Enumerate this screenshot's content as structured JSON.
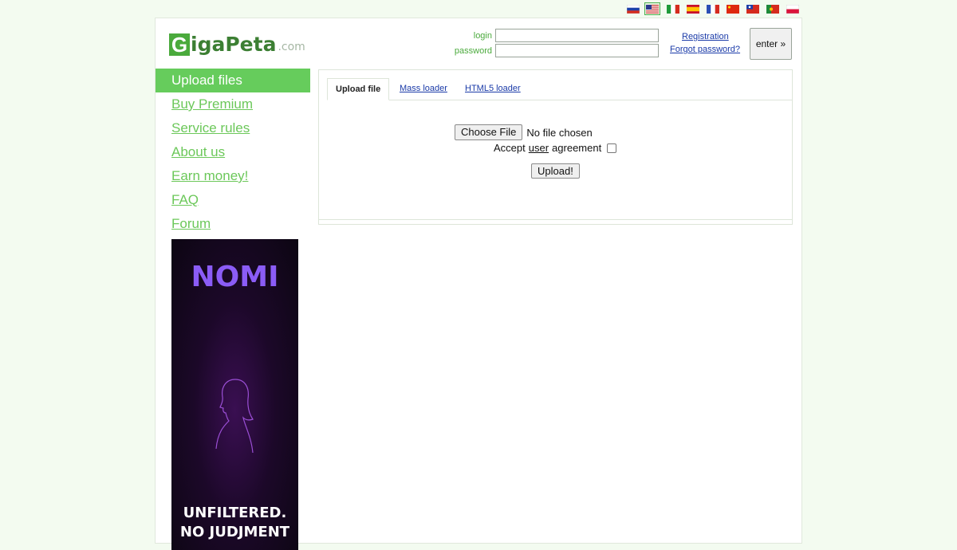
{
  "languages": [
    {
      "code": "ru",
      "selected": false
    },
    {
      "code": "en",
      "selected": true
    },
    {
      "code": "it",
      "selected": false
    },
    {
      "code": "es",
      "selected": false
    },
    {
      "code": "fr",
      "selected": false
    },
    {
      "code": "cn",
      "selected": false
    },
    {
      "code": "tw",
      "selected": false
    },
    {
      "code": "pt",
      "selected": false
    },
    {
      "code": "pl",
      "selected": false
    }
  ],
  "logo": {
    "initial": "G",
    "rest": "igaPeta",
    "suffix": ".com"
  },
  "login": {
    "login_label": "login",
    "password_label": "password",
    "login_value": "",
    "password_value": "",
    "registration": "Registration",
    "forgot": "Forgot password?",
    "enter": "enter »"
  },
  "nav": [
    {
      "label": "Upload files",
      "active": true
    },
    {
      "label": "Buy Premium",
      "active": false
    },
    {
      "label": "Service rules",
      "active": false
    },
    {
      "label": "About us",
      "active": false
    },
    {
      "label": "Earn money!",
      "active": false
    },
    {
      "label": "FAQ",
      "active": false
    },
    {
      "label": "Forum",
      "active": false
    }
  ],
  "ad": {
    "brand": "NOMI",
    "tagline1": "UNFILTERED.",
    "tagline2": "NO JUDJMENT"
  },
  "tabs": [
    {
      "label": "Upload file",
      "active": true
    },
    {
      "label": "Mass loader",
      "active": false
    },
    {
      "label": "HTML5 loader",
      "active": false
    }
  ],
  "upload": {
    "choose_file": "Choose File",
    "file_status": "No file chosen",
    "accept_before": "Accept",
    "accept_link": "user",
    "accept_after": "agreement",
    "accepted": false,
    "submit": "Upload!"
  },
  "colors": {
    "accent": "#66cc5c",
    "link": "#1a3aa8",
    "logo_green": "#4aaa3c"
  }
}
